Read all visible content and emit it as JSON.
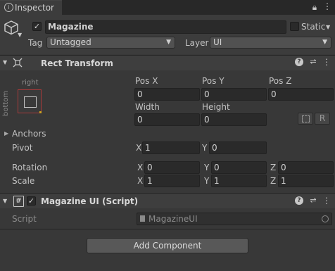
{
  "tab": {
    "title": "Inspector"
  },
  "object": {
    "name": "Magazine",
    "static_label": "Static"
  },
  "tag": {
    "label": "Tag",
    "value": "Untagged"
  },
  "layer": {
    "label": "Layer",
    "value": "UI"
  },
  "rect_transform": {
    "title": "Rect Transform",
    "anchor_preset": {
      "h": "right",
      "v": "bottom"
    },
    "posx_label": "Pos X",
    "posy_label": "Pos Y",
    "posz_label": "Pos Z",
    "posx": "0",
    "posy": "0",
    "posz": "0",
    "width_label": "Width",
    "height_label": "Height",
    "width": "0",
    "height": "0",
    "r_button": "R",
    "anchors_label": "Anchors",
    "pivot_label": "Pivot",
    "pivot_x": "1",
    "pivot_y": "0",
    "rotation_label": "Rotation",
    "rot_x": "0",
    "rot_y": "0",
    "rot_z": "0",
    "scale_label": "Scale",
    "scale_x": "1",
    "scale_y": "1",
    "scale_z": "1",
    "axis_x": "X",
    "axis_y": "Y",
    "axis_z": "Z"
  },
  "script_component": {
    "title": "Magazine UI (Script)",
    "script_label": "Script",
    "script_value": "MagazineUI"
  },
  "add_component": "Add Component"
}
